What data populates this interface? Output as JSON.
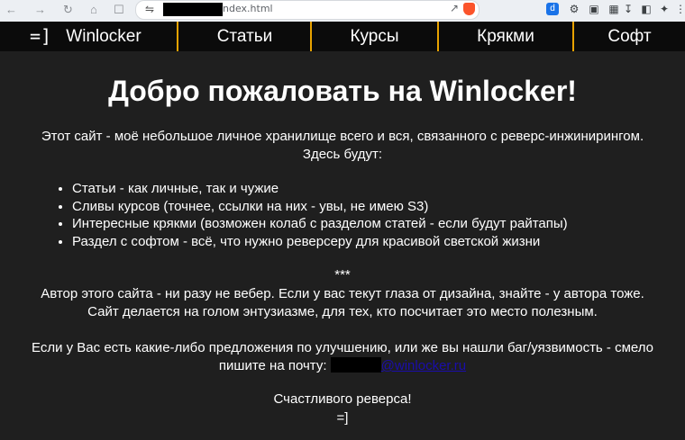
{
  "browser": {
    "url_suffix": "ndex.html"
  },
  "nav": {
    "brand": "Winlocker",
    "items": [
      "Статьи",
      "Курсы",
      "Крякми",
      "Софт"
    ],
    "accent": "#e8a200"
  },
  "content": {
    "title": "Добро пожаловать на Winlocker!",
    "intro1": "Этот сайт - моё небольшое личное хранилище всего и вся, связанного с реверс-инжинирингом.",
    "intro2": "Здесь будут:",
    "list": [
      "Статьи - как личные, так и чужие",
      "Сливы курсов (точнее, ссылки на них - увы, не имею S3)",
      "Интересные крякми (возможен колаб с разделом статей - если будут райтапы)",
      "Раздел с софтом - всё, что нужно реверсеру для красивой светской жизни"
    ],
    "stars": "***",
    "about1": "Автор этого сайта - ни разу не вебер. Если у вас текут глаза от дизайна, знайте - у автора тоже.",
    "about2": "Сайт делается на голом энтузиазме, для тех, кто посчитает это место полезным.",
    "contact1": "Если у Вас есть какие-либо предложения по улучшению, или же вы нашли баг/уязвимость - смело",
    "contact2": "пишите на почту:",
    "email_domain": "@winlocker.ru",
    "bye": "Счастливого реверса!",
    "smile": "=]",
    "burger": "=]"
  }
}
